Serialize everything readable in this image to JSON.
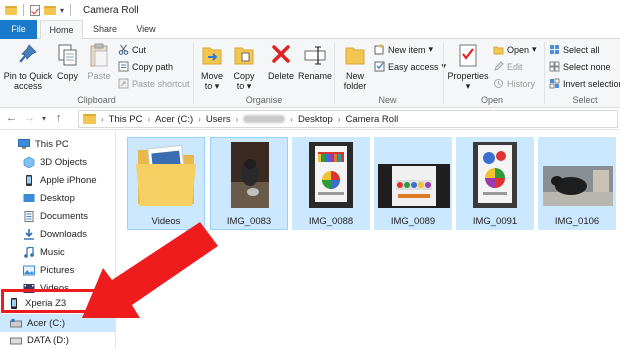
{
  "window": {
    "title": "Camera Roll"
  },
  "tabs": [
    "File",
    "Home",
    "Share",
    "View"
  ],
  "ribbon": {
    "clipboard": {
      "pin_label": "Pin to Quick access",
      "copy_label": "Copy",
      "paste_label": "Paste",
      "cut_label": "Cut",
      "copy_path_label": "Copy path",
      "paste_shortcut_label": "Paste shortcut",
      "group_label": "Clipboard"
    },
    "organise": {
      "move_to_label": "Move to",
      "copy_to_label": "Copy to",
      "delete_label": "Delete",
      "rename_label": "Rename",
      "group_label": "Organise"
    },
    "new": {
      "new_folder_label": "New folder",
      "new_item_label": "New item",
      "easy_access_label": "Easy access",
      "group_label": "New"
    },
    "open": {
      "properties_label": "Properties",
      "open_label": "Open",
      "edit_label": "Edit",
      "history_label": "History",
      "group_label": "Open"
    },
    "select": {
      "select_all_label": "Select all",
      "select_none_label": "Select none",
      "invert_label": "Invert selection",
      "group_label": "Select"
    }
  },
  "address": {
    "crumbs": [
      "This PC",
      "Acer (C:)",
      "Users",
      "Desktop",
      "Camera Roll"
    ]
  },
  "navigation": {
    "items": [
      {
        "label": "This PC",
        "icon": "monitor-icon"
      },
      {
        "label": "3D Objects",
        "icon": "3d-objects-icon"
      },
      {
        "label": "Apple iPhone",
        "icon": "phone-icon"
      },
      {
        "label": "Desktop",
        "icon": "desktop-icon"
      },
      {
        "label": "Documents",
        "icon": "documents-icon"
      },
      {
        "label": "Downloads",
        "icon": "downloads-icon"
      },
      {
        "label": "Music",
        "icon": "music-icon"
      },
      {
        "label": "Pictures",
        "icon": "pictures-icon"
      },
      {
        "label": "Videos",
        "icon": "videos-icon"
      },
      {
        "label": "Xperia Z3",
        "icon": "phone-icon"
      },
      {
        "label": "Acer (C:)",
        "icon": "drive-icon"
      },
      {
        "label": "DATA (D:)",
        "icon": "drive-icon"
      }
    ]
  },
  "files": [
    {
      "name": "Videos",
      "type": "folder"
    },
    {
      "name": "IMG_0083",
      "type": "image"
    },
    {
      "name": "IMG_0088",
      "type": "image"
    },
    {
      "name": "IMG_0089",
      "type": "image"
    },
    {
      "name": "IMG_0091",
      "type": "image"
    },
    {
      "name": "IMG_0106",
      "type": "image"
    }
  ],
  "colors": {
    "file_tab": "#1979ca",
    "selection": "#cce8ff",
    "selection_border": "#99d1ff",
    "annotation_red": "#ee1c1c"
  }
}
